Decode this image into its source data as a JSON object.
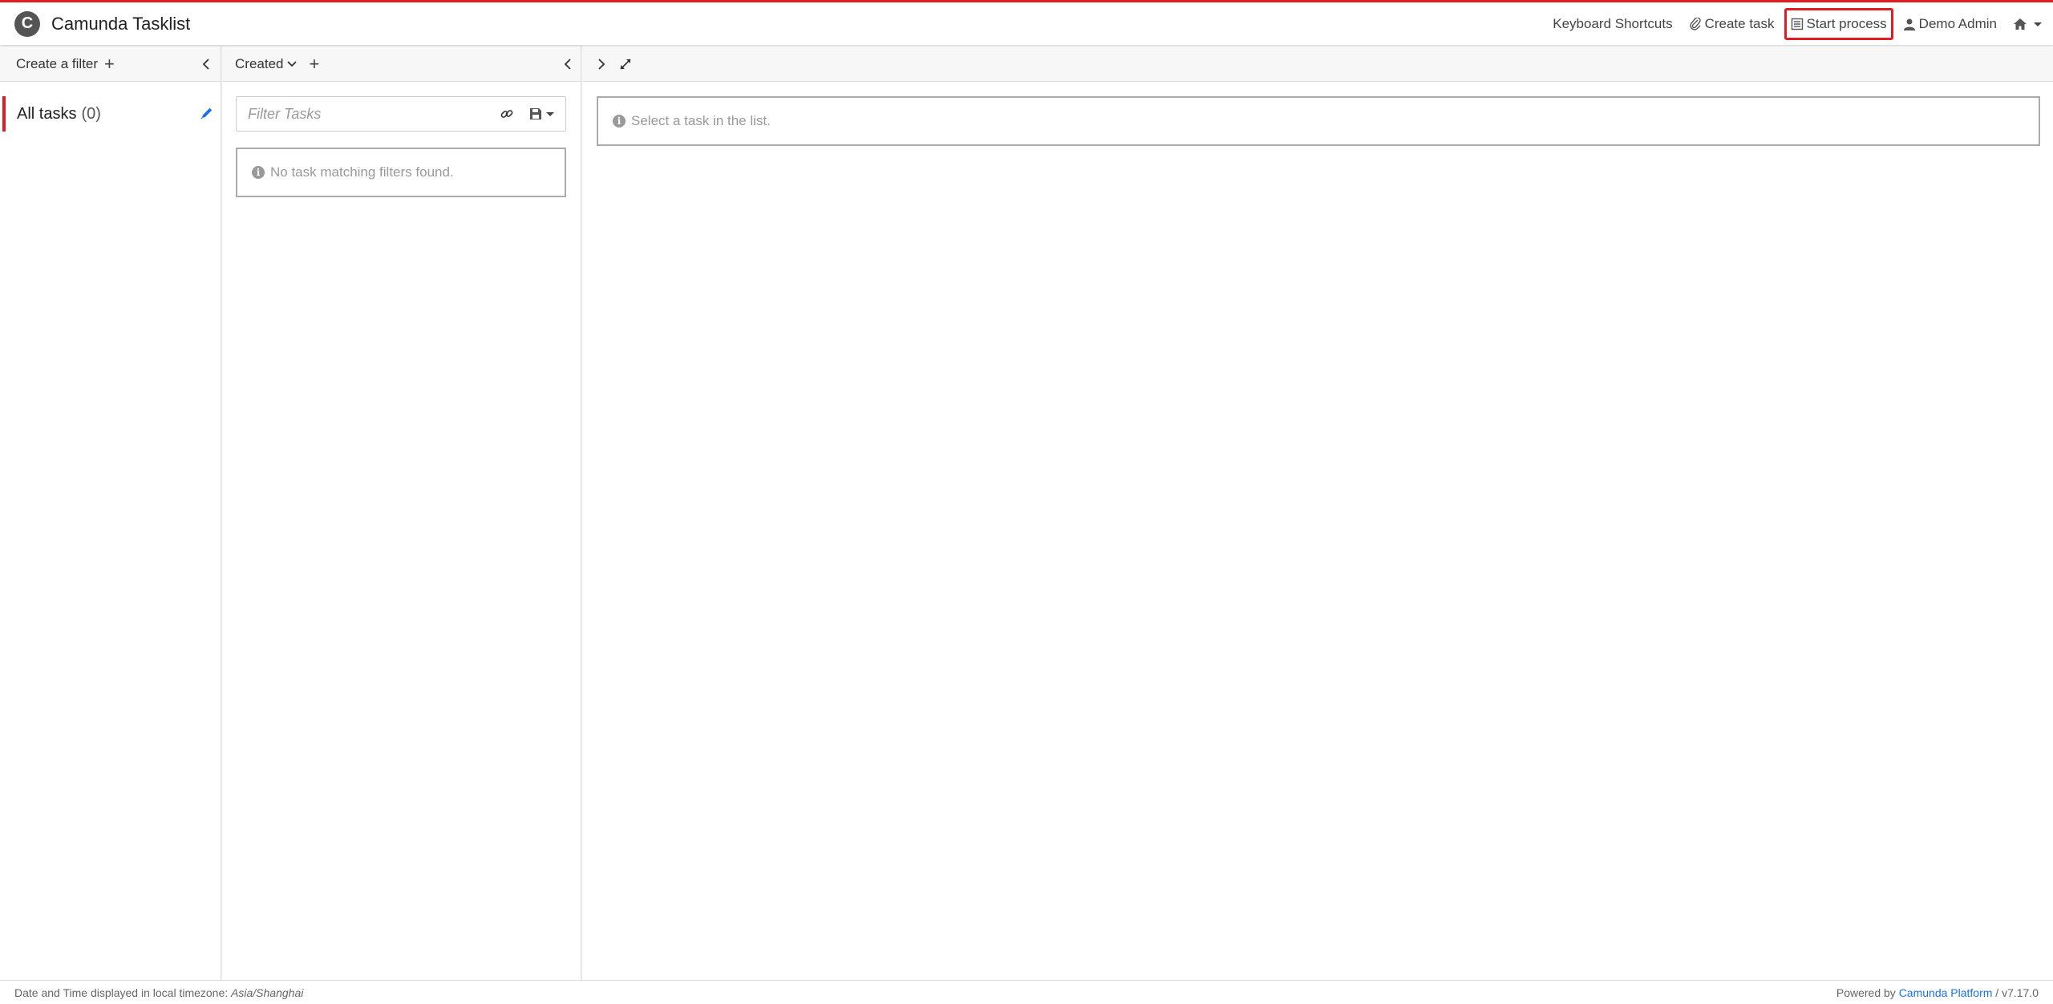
{
  "app": {
    "title": "Camunda Tasklist",
    "logo_letter": "C"
  },
  "colors": {
    "accent": "#e31b23",
    "link": "#1a73e8"
  },
  "nav": {
    "keyboard_shortcuts": "Keyboard Shortcuts",
    "create_task": "Create task",
    "start_process": "Start process",
    "user": "Demo Admin",
    "home_icon": "home-icon"
  },
  "filters": {
    "create_label": "Create a filter",
    "items": [
      {
        "name": "All tasks",
        "count": "(0)"
      }
    ]
  },
  "list": {
    "sort_label": "Created",
    "search_placeholder": "Filter Tasks",
    "empty_message": "No task matching filters found."
  },
  "detail": {
    "empty_message": "Select a task in the list."
  },
  "footer": {
    "timezone_text": "Date and Time displayed in local timezone:",
    "timezone_value": "Asia/Shanghai",
    "powered_by": "Powered by",
    "platform": "Camunda Platform",
    "version": "/ v7.17.0"
  }
}
